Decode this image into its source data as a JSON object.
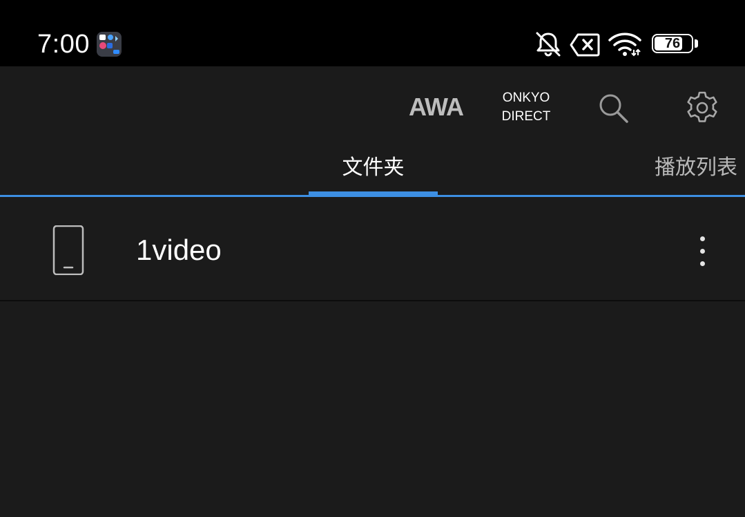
{
  "status_bar": {
    "time": "7:00",
    "battery_level": "76",
    "icons": [
      "app-folder-icon",
      "mute-bell-icon",
      "no-sim-icon",
      "wifi-icon",
      "battery-icon"
    ]
  },
  "toolbar": {
    "awa_label": "AWA",
    "onkyo_line1": "ONKYO",
    "onkyo_line2": "DIRECT",
    "search_icon": "search-icon",
    "settings_icon": "gear-icon"
  },
  "tabs": [
    {
      "label": "文件夹",
      "selected": true
    },
    {
      "label": "播放列表",
      "selected": false
    }
  ],
  "list": {
    "items": [
      {
        "icon": "phone-device-icon",
        "title": "1video"
      }
    ]
  },
  "colors": {
    "accent": "#3d8fe3",
    "background": "#1b1b1b",
    "status_bar": "#000000"
  }
}
